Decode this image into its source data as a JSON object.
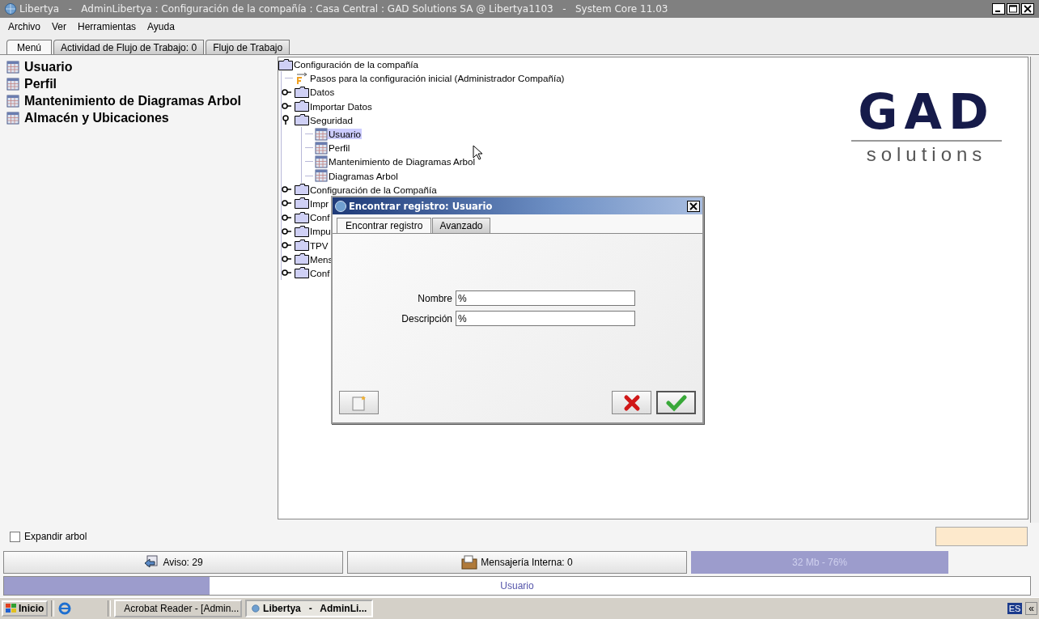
{
  "window": {
    "title": "Libertya   -   AdminLibertya : Configuración de la compañía : Casa Central : GAD Solutions SA @ Libertya1103   -   System Core 11.03"
  },
  "menu": [
    {
      "label": "Archivo"
    },
    {
      "label": "Ver"
    },
    {
      "label": "Herramientas"
    },
    {
      "label": "Ayuda"
    }
  ],
  "tabs": [
    {
      "label": "Menú",
      "selected": true
    },
    {
      "label": "Actividad de Flujo de Trabajo: 0",
      "selected": false
    },
    {
      "label": "Flujo de Trabajo",
      "selected": false
    }
  ],
  "favorites": [
    "Usuario",
    "Perfil",
    "Mantenimiento de Diagramas Arbol",
    "Almacén y Ubicaciones"
  ],
  "tree": {
    "label": "Configuración de la compañía",
    "kind": "folder",
    "children": [
      {
        "label": "Pasos para la configuración inicial (Administrador Compañía)",
        "kind": "workflow"
      },
      {
        "label": "Datos",
        "kind": "folder",
        "expanded": false
      },
      {
        "label": "Importar Datos",
        "kind": "folder",
        "expanded": false
      },
      {
        "label": "Seguridad",
        "kind": "folder",
        "expanded": true,
        "children": [
          {
            "label": "Usuario",
            "kind": "window",
            "selected": true
          },
          {
            "label": "Perfil",
            "kind": "window",
            "selected": false
          },
          {
            "label": "Mantenimiento de Diagramas Arbol",
            "kind": "window",
            "selected": false
          },
          {
            "label": "Diagramas Arbol",
            "kind": "window",
            "selected": false
          }
        ]
      },
      {
        "label": "Configuración de la Compañía",
        "kind": "folder",
        "expanded": false
      },
      {
        "label": "Impr",
        "kind": "folder",
        "expanded": false
      },
      {
        "label": "Conf",
        "kind": "folder",
        "expanded": false
      },
      {
        "label": "Impu",
        "kind": "folder",
        "expanded": false
      },
      {
        "label": "TPV",
        "kind": "folder",
        "expanded": false
      },
      {
        "label": "Mens",
        "kind": "folder",
        "expanded": false
      },
      {
        "label": "Conf",
        "kind": "folder",
        "expanded": false
      }
    ]
  },
  "logo": {
    "name": "GAD",
    "tagline": "solutions"
  },
  "dialog": {
    "title": "Encontrar registro: Usuario",
    "tabs": [
      {
        "label": "Encontrar registro",
        "selected": true
      },
      {
        "label": "Avanzado",
        "selected": false
      }
    ],
    "fields": [
      {
        "label": "Nombre",
        "value": "%"
      },
      {
        "label": "Descripción",
        "value": "%"
      }
    ]
  },
  "expand_tree": {
    "label": "Expandir arbol",
    "checked": false
  },
  "status": {
    "notices": "Aviso: 29",
    "messages": "Mensajería Interna: 0",
    "memory": "32 Mb - 76%"
  },
  "progress": {
    "label": "Usuario",
    "level": 0.2
  },
  "taskbar": {
    "start": "Inicio",
    "tasks": [
      {
        "label": "Acrobat Reader - [Admin...",
        "kind": "pdf",
        "selected": false
      },
      {
        "label": "Libertya   -   AdminLi...",
        "kind": "app",
        "selected": true
      }
    ],
    "language": "ES",
    "chevron": "«"
  }
}
